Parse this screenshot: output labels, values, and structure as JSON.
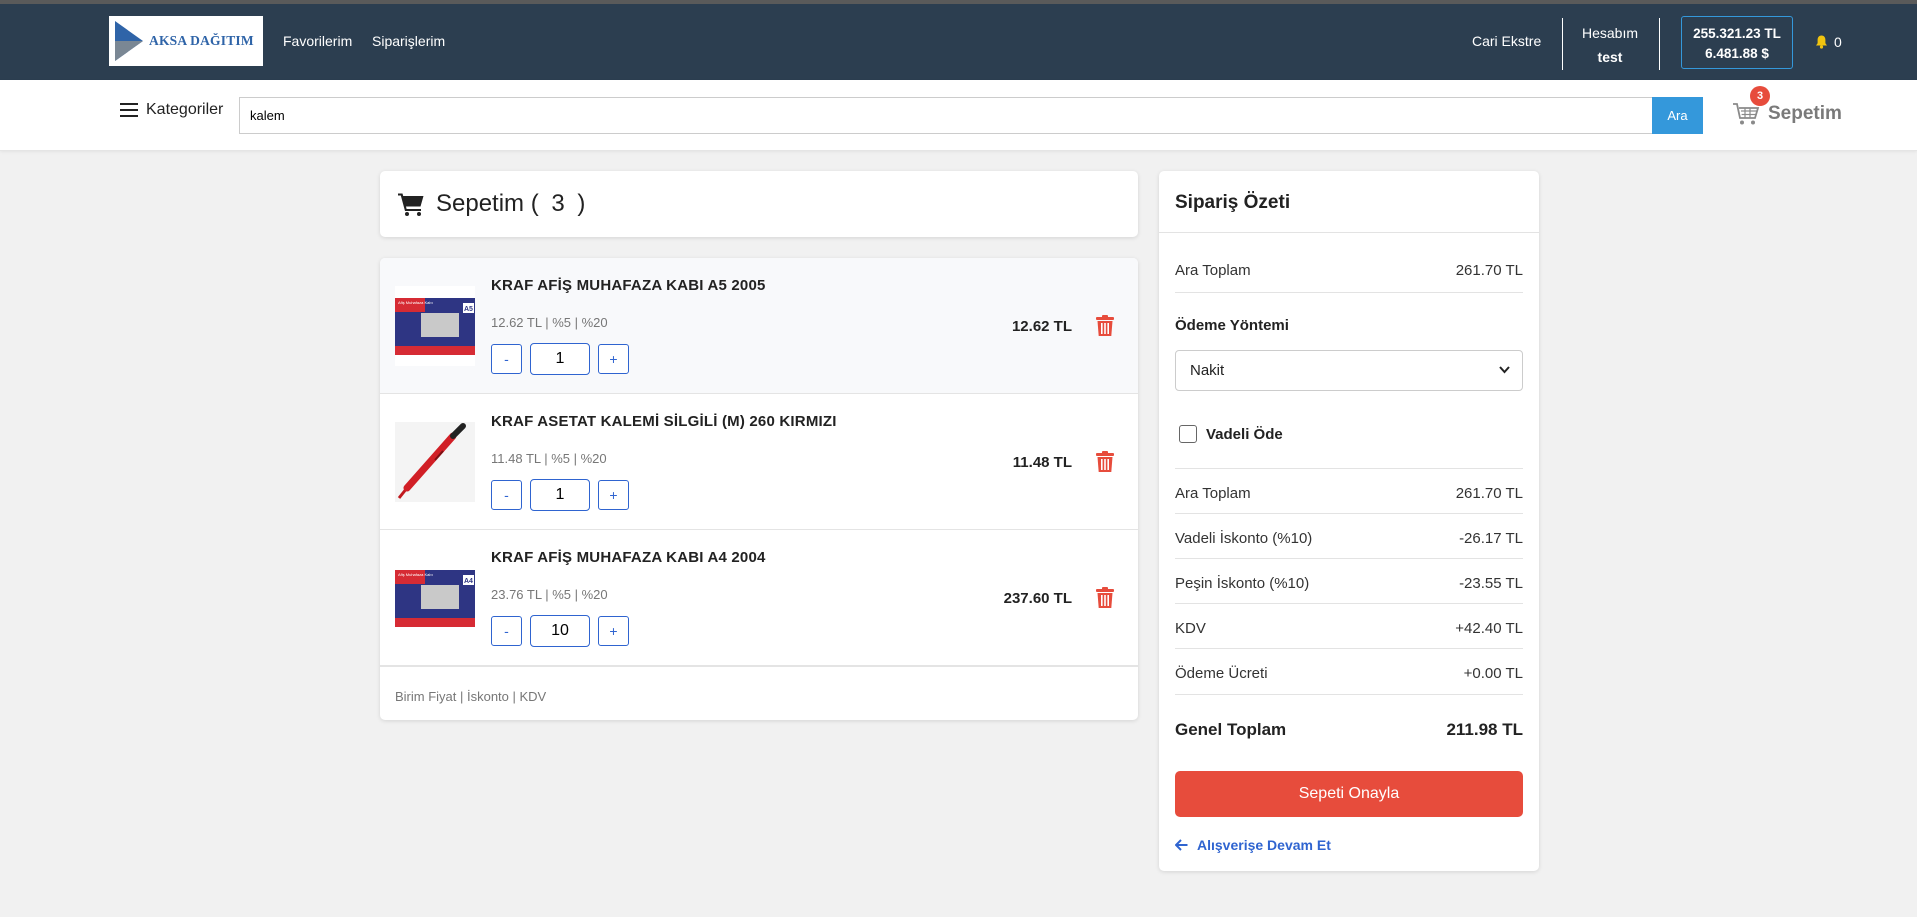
{
  "navbar": {
    "logo_text": "AKSA DAĞITIM",
    "links": [
      "Favorilerim",
      "Siparişlerim"
    ],
    "account_statement": "Cari Ekstre",
    "account_label": "Hesabım",
    "account_user": "test",
    "balance_tl": "255.321.23 TL",
    "balance_usd": "6.481.88 $",
    "notification_count": "0"
  },
  "search": {
    "categories_label": "Kategoriler",
    "value": "kalem",
    "button_label": "Ara",
    "cart_label": "Sepetim",
    "cart_count": "3"
  },
  "cart": {
    "title": "Sepetim",
    "count_open": "(",
    "count": "3",
    "count_close": ")",
    "items": [
      {
        "name": "KRAF AFİŞ MUHAFAZA KABI A5 2005",
        "details": "12.62 TL | %5 | %20",
        "quantity": "1",
        "total": "12.62 TL",
        "minus": "-",
        "plus": "+",
        "thumb_label": "Afiş Muhafaza Kabı",
        "thumb_size": "A5"
      },
      {
        "name": "KRAF ASETAT KALEMİ SİLGİLİ (M) 260 KIRMIZI",
        "details": "11.48 TL | %5 | %20",
        "quantity": "1",
        "total": "11.48 TL",
        "minus": "-",
        "plus": "+"
      },
      {
        "name": "KRAF AFİŞ MUHAFAZA KABI A4 2004",
        "details": "23.76 TL | %5 | %20",
        "quantity": "10",
        "total": "237.60 TL",
        "minus": "-",
        "plus": "+",
        "thumb_label": "Afiş Muhafaza Kabı",
        "thumb_size": "A4"
      }
    ],
    "legend": "Birim Fiyat | İskonto | KDV"
  },
  "summary": {
    "title": "Sipariş Özeti",
    "subtotal_label": "Ara Toplam",
    "subtotal_value": "261.70 TL",
    "payment_method_label": "Ödeme Yöntemi",
    "payment_method_value": "Nakit",
    "deferred_label": "Vadeli Öde",
    "rows": [
      {
        "label": "Ara Toplam",
        "value": "261.70 TL"
      },
      {
        "label": "Vadeli İskonto (%10)",
        "value": "-26.17 TL"
      },
      {
        "label": "Peşin İskonto (%10)",
        "value": "-23.55 TL"
      },
      {
        "label": "KDV",
        "value": "+42.40 TL"
      },
      {
        "label": "Ödeme Ücreti",
        "value": "+0.00 TL"
      }
    ],
    "grand_total_label": "Genel Toplam",
    "grand_total_value": "211.98 TL",
    "confirm_label": "Sepeti Onayla",
    "continue_label": "Alışverişe Devam Et"
  },
  "colors": {
    "navbar": "#2c3e50",
    "accent_blue": "#3498db",
    "danger_red": "#e74c3c",
    "link_blue": "#2f64d0"
  },
  "icons": [
    "logo-triangle-icon",
    "hamburger-icon",
    "cart-icon",
    "bell-icon",
    "trash-icon",
    "arrow-left-icon",
    "chevron-down-icon"
  ]
}
